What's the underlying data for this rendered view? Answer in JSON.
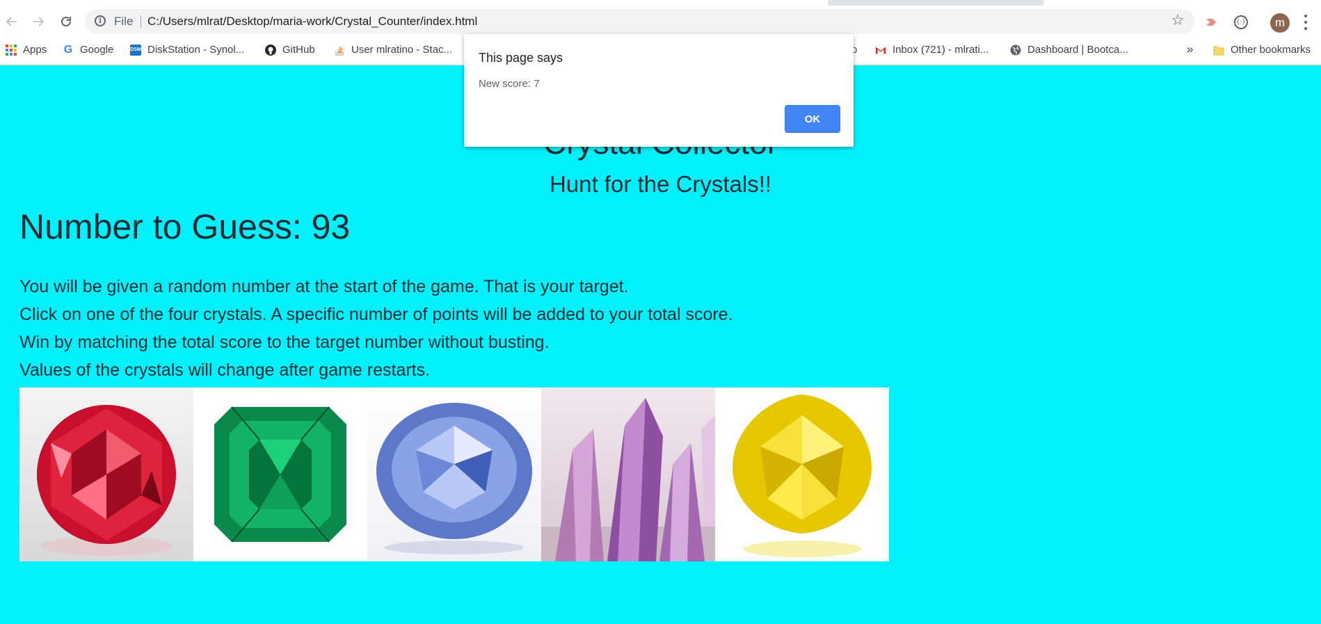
{
  "browser": {
    "scheme_label": "File",
    "url": "C:/Users/mlrat/Desktop/maria-work/Crystal_Counter/index.html",
    "profile_initial": "m",
    "bookmarks": [
      {
        "label": "Apps",
        "icon": "apps-grid-icon"
      },
      {
        "label": "Google",
        "icon": "google-icon"
      },
      {
        "label": "DiskStation - Synol...",
        "icon": "dsm-icon"
      },
      {
        "label": "GitHub",
        "icon": "github-icon"
      },
      {
        "label": "User mlratino - Stac...",
        "icon": "stackoverflow-icon"
      },
      {
        "label": "o",
        "icon": ""
      },
      {
        "label": "Inbox (721) - mlrati...",
        "icon": "gmail-icon"
      },
      {
        "label": "Dashboard | Bootca...",
        "icon": "globe-icon"
      },
      {
        "label": "»",
        "icon": ""
      },
      {
        "label": "Other bookmarks",
        "icon": "folder-icon"
      }
    ]
  },
  "dialog": {
    "title": "This page says",
    "message": "New score: 7",
    "ok_label": "OK"
  },
  "page": {
    "title": "Crystal Collector",
    "subtitle": "Hunt for the Crystals!!",
    "target_text": "Number to Guess: 93",
    "instructions": [
      "You will be given a random number at the start of the game. That is your target.",
      "Click on one of the four crystals. A specific number of points will be added to your total score.",
      "Win by matching the total score to the target number without busting.",
      "Values of the crystals will change after game restarts."
    ],
    "crystals": [
      {
        "name": "ruby"
      },
      {
        "name": "emerald"
      },
      {
        "name": "sapphire"
      },
      {
        "name": "amethyst"
      },
      {
        "name": "yellow-diamond"
      }
    ]
  },
  "colors": {
    "page_background": "#00f1fb",
    "dialog_button": "#4285f4",
    "text": "#1c2b33"
  }
}
